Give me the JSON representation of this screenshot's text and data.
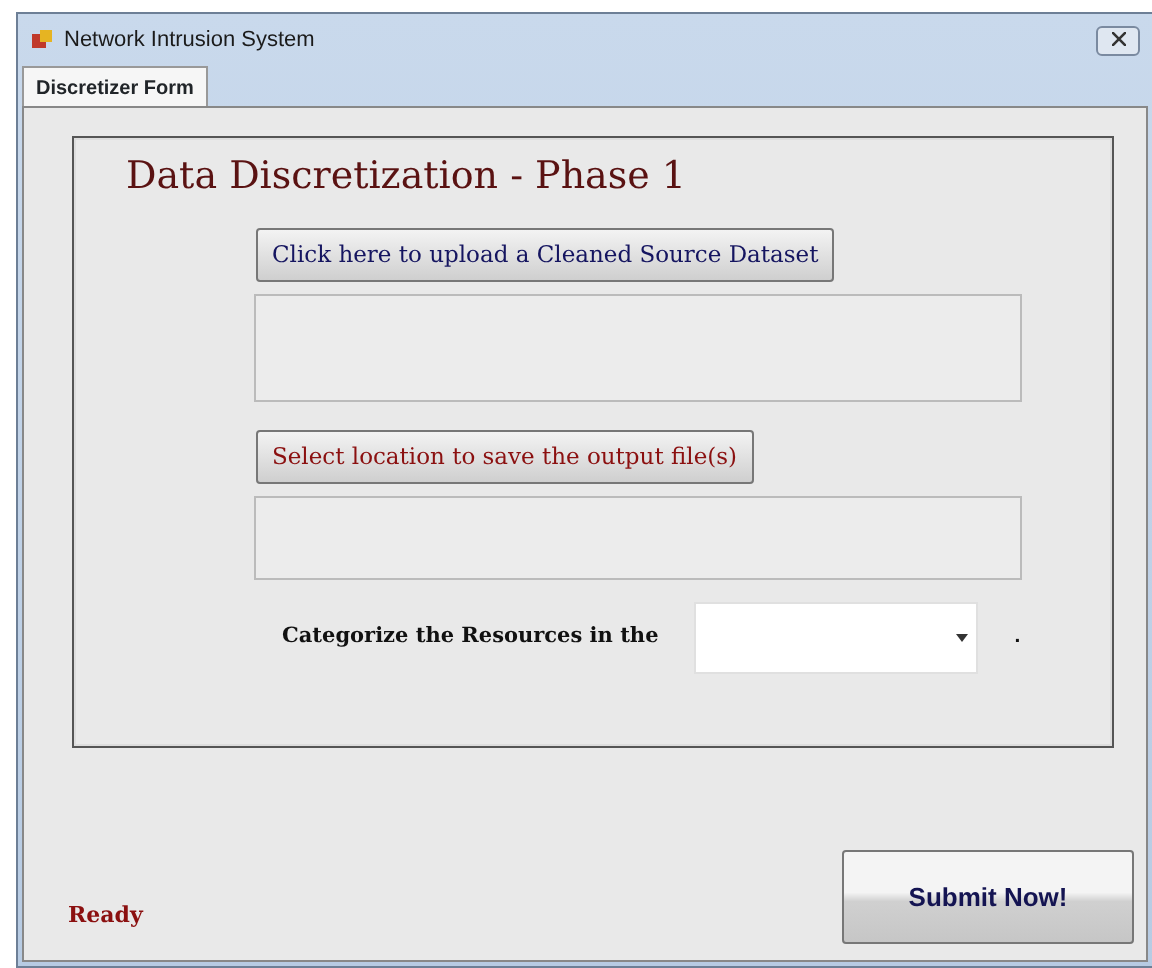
{
  "window": {
    "title": "Network Intrusion System"
  },
  "tabs": [
    {
      "label": "Discretizer Form",
      "selected": true
    }
  ],
  "form": {
    "heading": "Data Discretization - Phase 1",
    "upload_button": "Click here to upload a Cleaned Source Dataset",
    "save_button": "Select location to save the output file(s)",
    "category_label": "Categorize the Resources in the",
    "trailing_mark": "."
  },
  "submit_button": "Submit Now!",
  "status": "Ready"
}
